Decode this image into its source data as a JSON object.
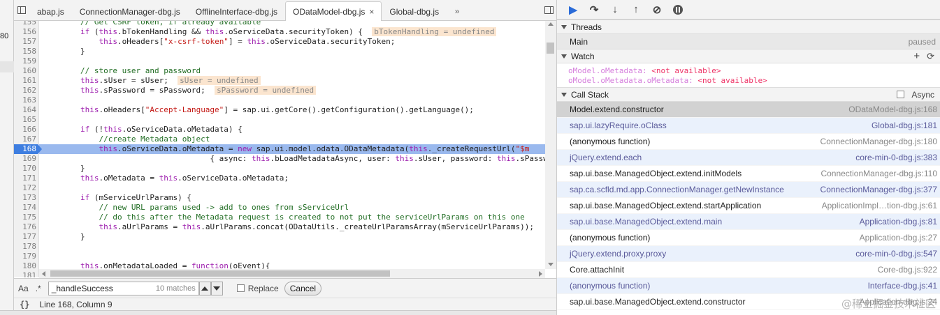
{
  "left_strip": {
    "fragment": "80"
  },
  "tabs": [
    {
      "label": "abap.js",
      "active": false
    },
    {
      "label": "ConnectionManager-dbg.js",
      "active": false
    },
    {
      "label": "OfflineInterface-dbg.js",
      "active": false
    },
    {
      "label": "ODataModel-dbg.js",
      "active": true,
      "close": "×"
    },
    {
      "label": "Global-dbg.js",
      "active": false
    }
  ],
  "tab_overflow": "»",
  "code_lines": [
    {
      "n": "155",
      "parts": [
        [
          "",
          "\t\t"
        ],
        [
          "cm",
          "// Get CSRF token, if already available"
        ]
      ]
    },
    {
      "n": "156",
      "parts": [
        [
          "",
          "\t\t"
        ],
        [
          "kw",
          "if"
        ],
        [
          "",
          " ("
        ],
        [
          "kw",
          "this"
        ],
        [
          "",
          ".bTokenHandling && "
        ],
        [
          "kw",
          "this"
        ],
        [
          "",
          ".oServiceData.securityToken) {  "
        ],
        [
          "hint",
          "bTokenHandling = undefined"
        ]
      ]
    },
    {
      "n": "157",
      "parts": [
        [
          "",
          "\t\t\t"
        ],
        [
          "kw",
          "this"
        ],
        [
          "",
          ".oHeaders["
        ],
        [
          "st",
          "\"x-csrf-token\""
        ],
        [
          "",
          "] = "
        ],
        [
          "kw",
          "this"
        ],
        [
          "",
          ".oServiceData.securityToken;"
        ]
      ]
    },
    {
      "n": "158",
      "parts": [
        [
          "",
          "\t\t}"
        ]
      ]
    },
    {
      "n": "159",
      "parts": [
        [
          "",
          ""
        ]
      ]
    },
    {
      "n": "160",
      "parts": [
        [
          "",
          "\t\t"
        ],
        [
          "cm",
          "// store user and password"
        ]
      ]
    },
    {
      "n": "161",
      "parts": [
        [
          "",
          "\t\t"
        ],
        [
          "kw",
          "this"
        ],
        [
          "",
          ".sUser = sUser;  "
        ],
        [
          "hint",
          "sUser = undefined"
        ]
      ]
    },
    {
      "n": "162",
      "parts": [
        [
          "",
          "\t\t"
        ],
        [
          "kw",
          "this"
        ],
        [
          "",
          ".sPassword = sPassword;  "
        ],
        [
          "hint",
          "sPassword = undefined"
        ]
      ]
    },
    {
      "n": "163",
      "parts": [
        [
          "",
          ""
        ]
      ]
    },
    {
      "n": "164",
      "parts": [
        [
          "",
          "\t\t"
        ],
        [
          "kw",
          "this"
        ],
        [
          "",
          ".oHeaders["
        ],
        [
          "st",
          "\"Accept-Language\""
        ],
        [
          "",
          "] = sap.ui.getCore().getConfiguration().getLanguage();"
        ]
      ]
    },
    {
      "n": "165",
      "parts": [
        [
          "",
          ""
        ]
      ]
    },
    {
      "n": "166",
      "parts": [
        [
          "",
          "\t\t"
        ],
        [
          "kw",
          "if"
        ],
        [
          "",
          " (!"
        ],
        [
          "kw",
          "this"
        ],
        [
          "",
          ".oServiceData.oMetadata) {"
        ]
      ]
    },
    {
      "n": "167",
      "parts": [
        [
          "",
          "\t\t\t"
        ],
        [
          "cm",
          "//create Metadata object"
        ]
      ]
    },
    {
      "n": "168",
      "bp": true,
      "parts": [
        [
          "",
          "\t\t\t"
        ],
        [
          "kw",
          "this"
        ],
        [
          "",
          ".oServiceData.oMetadata = "
        ],
        [
          "kw",
          "new"
        ],
        [
          "",
          " sap.ui.model.odata.ODataMetadata("
        ],
        [
          "kw",
          "this"
        ],
        [
          "",
          "._createRequestUrl("
        ],
        [
          "st",
          "\"$m"
        ]
      ]
    },
    {
      "n": "169",
      "parts": [
        [
          "",
          "\t\t\t\t\t\t\t\t\t{ async: "
        ],
        [
          "kw",
          "this"
        ],
        [
          "",
          ".bLoadMetadataAsync, user: "
        ],
        [
          "kw",
          "this"
        ],
        [
          "",
          ".sUser, password: "
        ],
        [
          "kw",
          "this"
        ],
        [
          "",
          ".sPassw"
        ]
      ]
    },
    {
      "n": "170",
      "parts": [
        [
          "",
          "\t\t}"
        ]
      ]
    },
    {
      "n": "171",
      "parts": [
        [
          "",
          "\t\t"
        ],
        [
          "kw",
          "this"
        ],
        [
          "",
          ".oMetadata = "
        ],
        [
          "kw",
          "this"
        ],
        [
          "",
          ".oServiceData.oMetadata;"
        ]
      ]
    },
    {
      "n": "172",
      "parts": [
        [
          "",
          ""
        ]
      ]
    },
    {
      "n": "173",
      "parts": [
        [
          "",
          "\t\t"
        ],
        [
          "kw",
          "if"
        ],
        [
          "",
          " (mServiceUrlParams) {"
        ]
      ]
    },
    {
      "n": "174",
      "parts": [
        [
          "",
          "\t\t\t"
        ],
        [
          "cm",
          "// new URL params used -> add to ones from sServiceUrl"
        ]
      ]
    },
    {
      "n": "175",
      "parts": [
        [
          "",
          "\t\t\t"
        ],
        [
          "cm",
          "// do this after the Metadata request is created to not put the serviceUrlParams on this one"
        ]
      ]
    },
    {
      "n": "176",
      "parts": [
        [
          "",
          "\t\t\t"
        ],
        [
          "kw",
          "this"
        ],
        [
          "",
          ".aUrlParams = "
        ],
        [
          "kw",
          "this"
        ],
        [
          "",
          ".aUrlParams.concat(ODataUtils._createUrlParamsArray(mServiceUrlParams));"
        ]
      ]
    },
    {
      "n": "177",
      "parts": [
        [
          "",
          "\t\t}"
        ]
      ]
    },
    {
      "n": "178",
      "parts": [
        [
          "",
          ""
        ]
      ]
    },
    {
      "n": "179",
      "parts": [
        [
          "",
          ""
        ]
      ]
    },
    {
      "n": "180",
      "parts": [
        [
          "",
          "\t\t"
        ],
        [
          "kw",
          "this"
        ],
        [
          "",
          ".onMetadataLoaded = "
        ],
        [
          "kw",
          "function"
        ],
        [
          "",
          "(oEvent){"
        ]
      ]
    },
    {
      "n": "181",
      "parts": [
        [
          "",
          ""
        ]
      ]
    }
  ],
  "search": {
    "aa": "Aa",
    "regex": ".*",
    "value": "_handleSuccess",
    "matches": "10 matches",
    "replace_label": "Replace",
    "cancel_label": "Cancel"
  },
  "status": {
    "braces": "{}",
    "position": "Line 168, Column 9"
  },
  "debugger_toolbar": {
    "resume": "▶",
    "step_over": "↷",
    "step_into": "↓",
    "step_out": "↑",
    "deactivate": "⊘"
  },
  "threads": {
    "title": "Threads",
    "items": [
      {
        "name": "Main",
        "state": "paused"
      }
    ]
  },
  "watch": {
    "title": "Watch",
    "add": "+",
    "refresh": "⟳",
    "items": [
      {
        "expr": "oModel.oMetadata: ",
        "value": "<not available>"
      },
      {
        "expr": "oModel.oMetadata.oMetadata: ",
        "value": "<not available>"
      }
    ]
  },
  "call_stack": {
    "title": "Call Stack",
    "async_label": "Async",
    "frames": [
      {
        "fn": "Model.extend.constructor",
        "loc": "ODataModel-dbg.js:168",
        "kind": "sel"
      },
      {
        "fn": "sap.ui.lazyRequire.oClass",
        "loc": "Global-dbg.js:181",
        "kind": "lib"
      },
      {
        "fn": "(anonymous function)",
        "loc": "ConnectionManager-dbg.js:180",
        "kind": ""
      },
      {
        "fn": "jQuery.extend.each",
        "loc": "core-min-0-dbg.js:383",
        "kind": "lib"
      },
      {
        "fn": "sap.ui.base.ManagedObject.extend.initModels",
        "loc": "ConnectionManager-dbg.js:110",
        "kind": ""
      },
      {
        "fn": "sap.ca.scfld.md.app.ConnectionManager.getNewInstance",
        "loc": "ConnectionManager-dbg.js:377",
        "kind": "lib"
      },
      {
        "fn": "sap.ui.base.ManagedObject.extend.startApplication",
        "loc": "ApplicationImpl…tion-dbg.js:61",
        "kind": ""
      },
      {
        "fn": "sap.ui.base.ManagedObject.extend.main",
        "loc": "Application-dbg.js:81",
        "kind": "lib"
      },
      {
        "fn": "(anonymous function)",
        "loc": "Application-dbg.js:27",
        "kind": ""
      },
      {
        "fn": "jQuery.extend.proxy.proxy",
        "loc": "core-min-0-dbg.js:547",
        "kind": "lib"
      },
      {
        "fn": "Core.attachInit",
        "loc": "Core-dbg.js:922",
        "kind": ""
      },
      {
        "fn": "(anonymous function)",
        "loc": "Interface-dbg.js:41",
        "kind": "lib"
      },
      {
        "fn": "sap.ui.base.ManagedObject.extend.constructor",
        "loc": "Application-dbg.js:24",
        "kind": ""
      }
    ]
  },
  "watermark": "@稀土掘金技术社区"
}
